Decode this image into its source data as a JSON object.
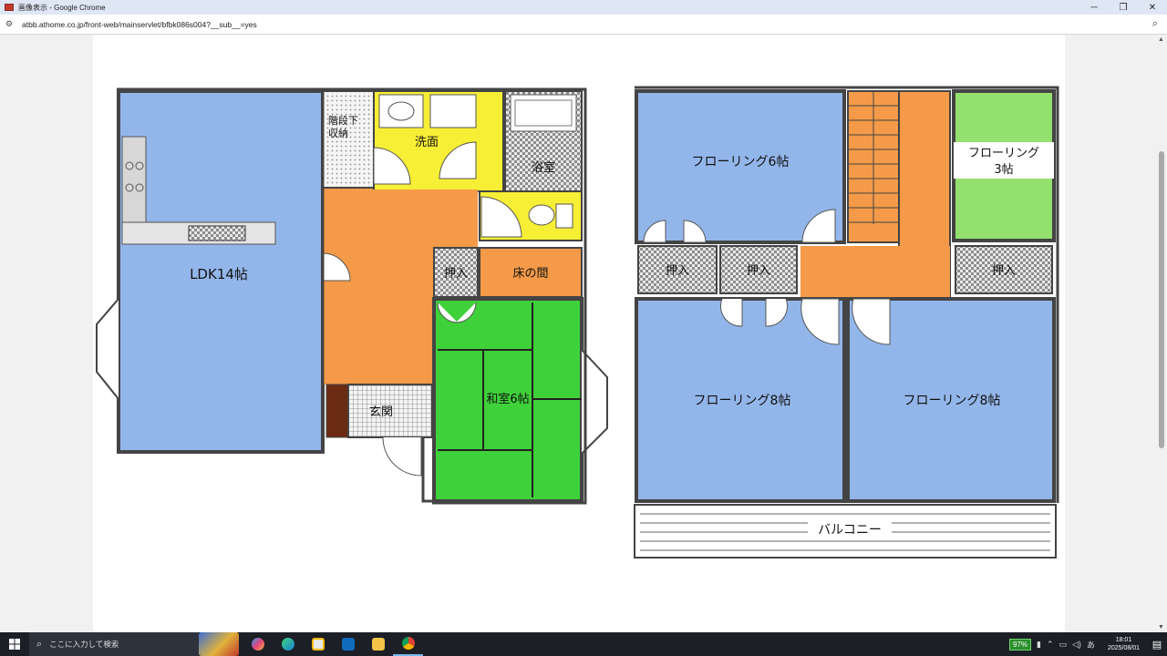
{
  "window": {
    "title": "画像表示 - Google Chrome",
    "minimize": "─",
    "restore": "❐",
    "close": "✕"
  },
  "address_bar": {
    "url": "atbb.athome.co.jp/front-web/mainservlet/bfbk086s004?__sub__=yes",
    "site_info_icon": "tune-icon",
    "zoom_icon": "zoom-icon"
  },
  "floor_plan": {
    "ground_floor": {
      "rooms": {
        "ldk": "LDK14帖",
        "stair_storage": "階段下\n収納",
        "washroom": "洗面",
        "bath": "浴室",
        "closet": "押入",
        "tokonoma": "床の間",
        "washitsu": "和室6帖",
        "entrance": "玄関"
      }
    },
    "upper_floor": {
      "rooms": {
        "flooring_6": "フローリング6帖",
        "flooring_3_line1": "フローリング",
        "flooring_3_line2": "3帖",
        "closet_a": "押入",
        "closet_b": "押入",
        "closet_c": "押入",
        "flooring_8_left": "フローリング8帖",
        "flooring_8_right": "フローリング8帖",
        "balcony": "バルコニー"
      }
    },
    "colors": {
      "western_room": "#93b6ea",
      "hall": "#f49a48",
      "tatami": "#3fd13a",
      "small_room": "#94e06e",
      "wet_area": "#f7ef35",
      "checker": "#9e9e9e",
      "wall": "#444444"
    }
  },
  "taskbar": {
    "search_placeholder": "ここに入力して検索",
    "battery": "97%",
    "ime": "あ",
    "time": "18:01",
    "date": "2025/08/01",
    "apps": [
      "copilot-icon",
      "edge-icon",
      "store-icon",
      "outlook-icon",
      "file-explorer-icon",
      "chrome-icon"
    ]
  }
}
